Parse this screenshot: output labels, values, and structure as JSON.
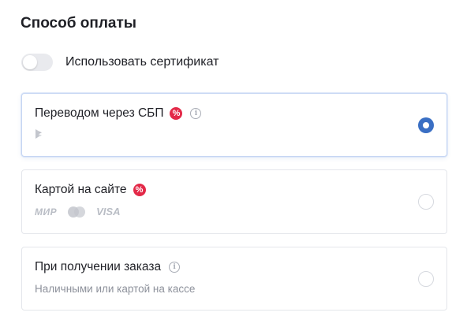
{
  "section": {
    "title": "Способ оплаты"
  },
  "certificate_toggle": {
    "label": "Использовать сертификат",
    "enabled": false
  },
  "payment_options": [
    {
      "title": "Переводом через СБП",
      "has_promo": true,
      "has_info": true,
      "selected": true,
      "sub_icon": "sbp-logo-icon"
    },
    {
      "title": "Картой на сайте",
      "has_promo": true,
      "has_info": false,
      "selected": false,
      "logos": [
        "МИР",
        "mastercard-logo-icon",
        "VISA"
      ]
    },
    {
      "title": "При получении заказа",
      "has_promo": false,
      "has_info": true,
      "selected": false,
      "subtitle": "Наличными или картой на кассе"
    }
  ],
  "icons": {
    "promo": "%",
    "info": "i"
  },
  "colors": {
    "accent": "#3a6fc4",
    "promo": "#e32948",
    "muted": "#8d919b"
  }
}
